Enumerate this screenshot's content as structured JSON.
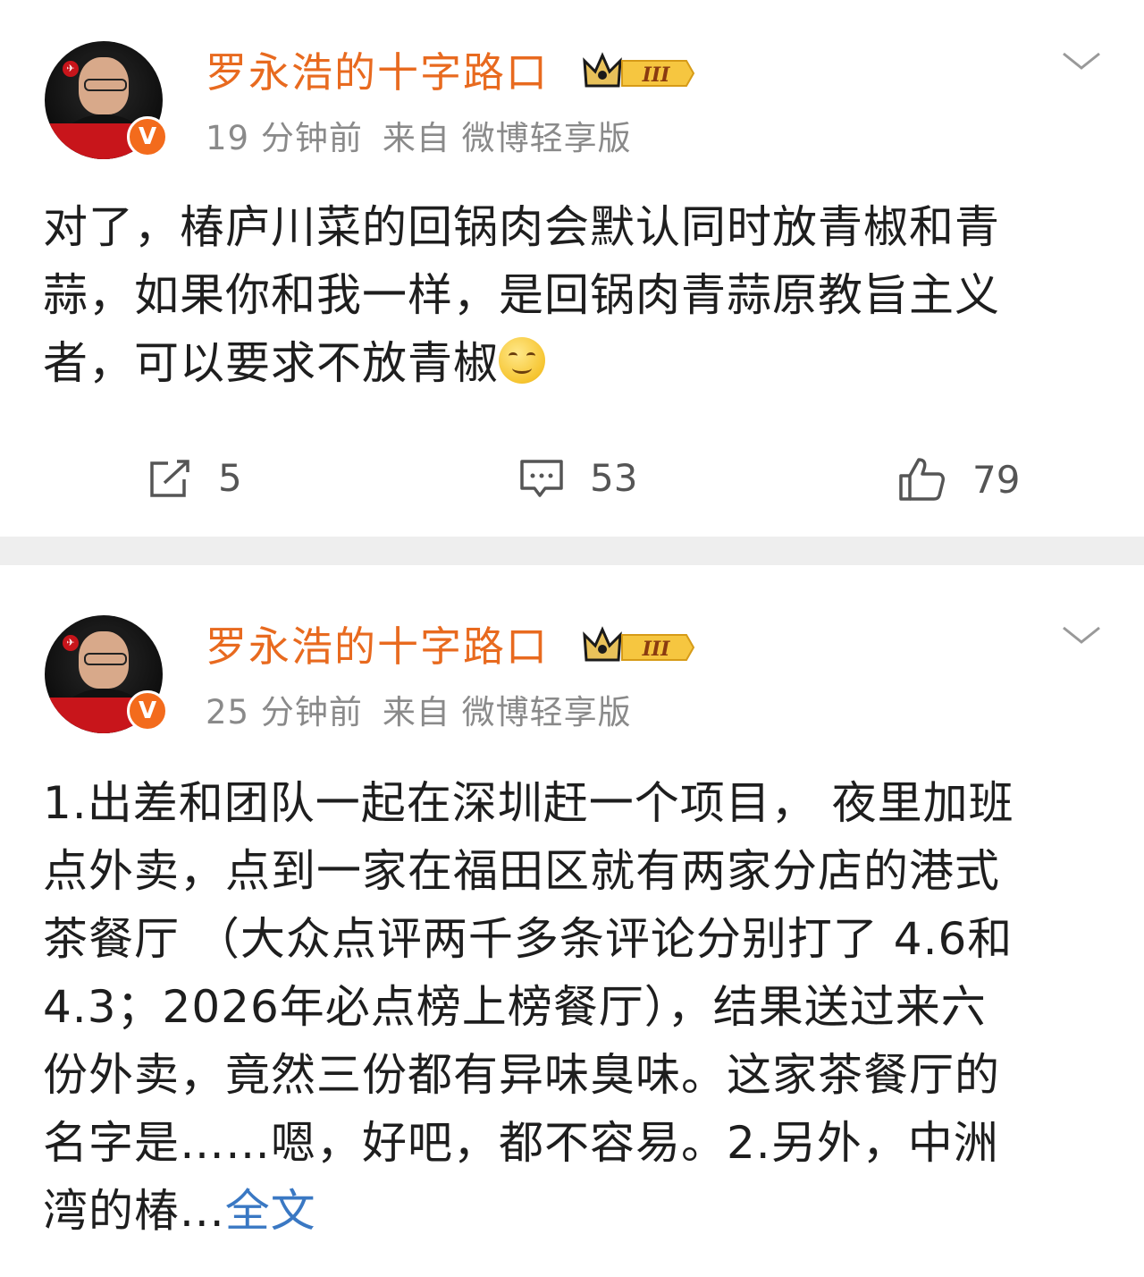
{
  "posts": [
    {
      "username": "罗永浩的十字路口",
      "rank_label": "III",
      "time": "19 分钟前",
      "source": "来自 微博轻享版",
      "avatar_caption": "罗永浩的十字路口",
      "verified_mark": "V",
      "text": "对了，椿庐川菜的回锅肉会默认同时放青椒和青蒜，如果你和我一样，是回锅肉青蒜原教旨主义者，可以要求不放青椒",
      "emoji": "smile-emoji",
      "reposts": "5",
      "comments": "53",
      "likes": "79"
    },
    {
      "username": "罗永浩的十字路口",
      "rank_label": "III",
      "time": "25 分钟前",
      "source": "来自 微博轻享版",
      "avatar_caption": "罗永浩的十字路口",
      "verified_mark": "V",
      "text_lines": [
        "1.出差和团队一起在深圳赶一个项目， 夜里加班",
        "点外卖，点到一家在福田区就有两家分店的港式",
        "茶餐厅 （大众点评两千多条评论分别打了 4.6和",
        "4.3；2026年必点榜上榜餐厅），结果送过来六",
        "份外卖，竟然三份都有异味臭味。这家茶餐厅的",
        "名字是……嗯，好吧，都不容易。2.另外，中洲",
        "湾的椿..."
      ],
      "full_text_link": "全文"
    }
  ],
  "colors": {
    "username": "#e86a1f",
    "meta": "#8a8a8a",
    "link": "#3a78c3",
    "divider": "#eeeeee"
  }
}
